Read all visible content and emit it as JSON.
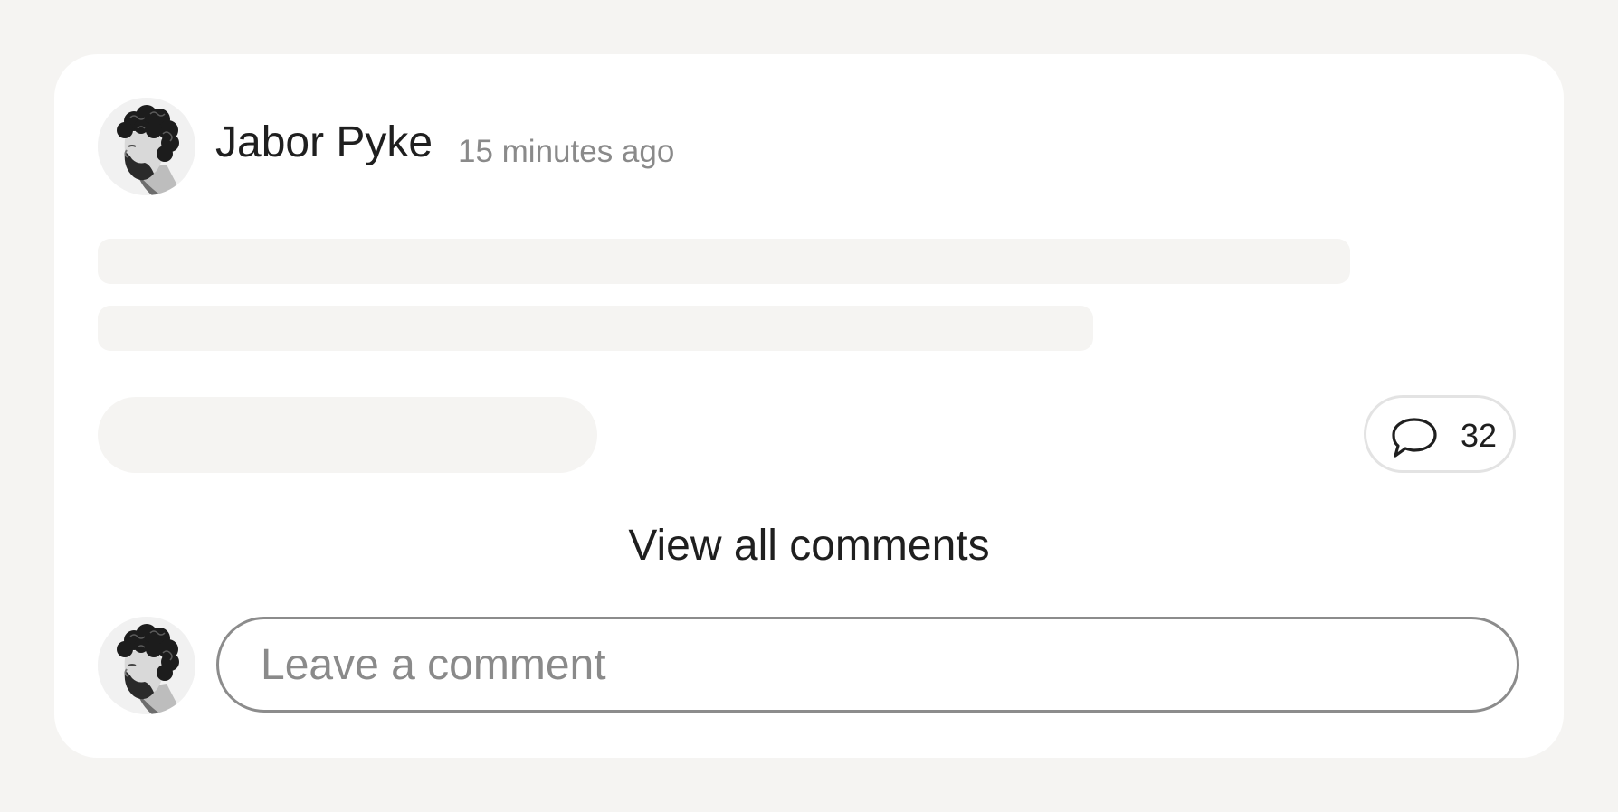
{
  "post": {
    "author": "Jabor Pyke",
    "time_ago": "15 minutes ago",
    "avatar_icon": "user-avatar-icon"
  },
  "actions": {
    "comment_icon": "speech-bubble-icon",
    "comment_count": "32",
    "view_all_label": "View all comments"
  },
  "composer": {
    "avatar_icon": "current-user-avatar-icon",
    "placeholder": "Leave a comment",
    "value": ""
  },
  "colors": {
    "page_background": "#f5f4f2",
    "card_background": "#ffffff",
    "skeleton": "#f5f4f2",
    "primary_text": "#1f1f1f",
    "secondary_text": "#8a8a8a",
    "input_border": "#8c8c8c"
  }
}
